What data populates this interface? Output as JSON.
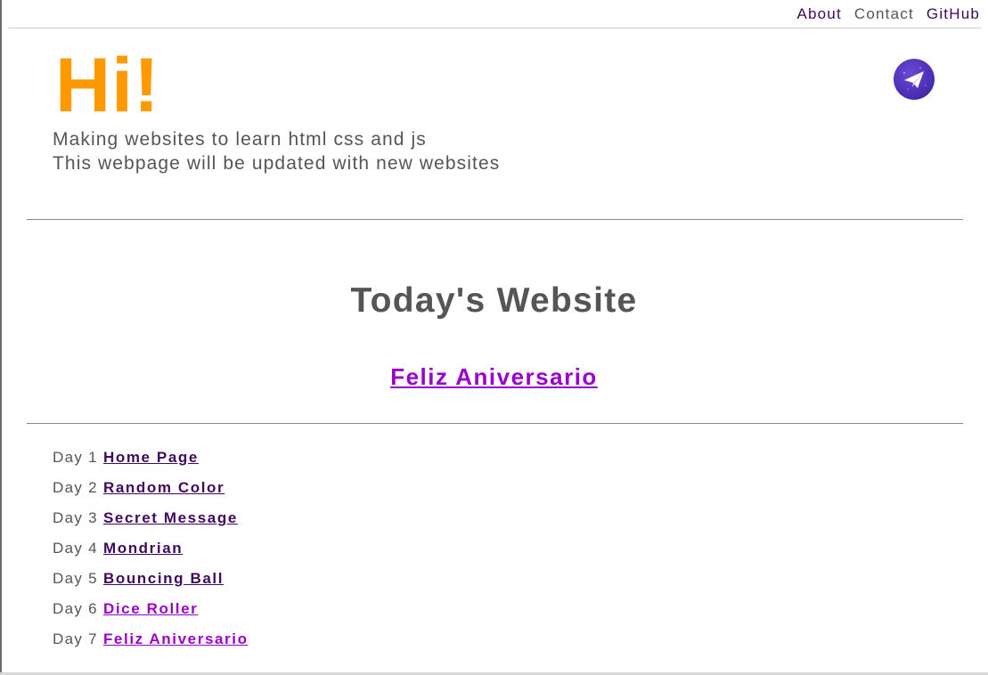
{
  "nav": {
    "about": "About",
    "contact": "Contact",
    "github": "GitHub"
  },
  "header": {
    "greeting": "Hi!",
    "tagline_1": "Making websites to learn html css and js",
    "tagline_2": "This webpage will be updated with new websites",
    "send_icon": "paper-plane-icon"
  },
  "today": {
    "title": "Today's Website",
    "link": "Feliz Aniversario"
  },
  "days": [
    {
      "prefix": "Day 1",
      "label": "Home Page"
    },
    {
      "prefix": "Day 2",
      "label": "Random Color"
    },
    {
      "prefix": "Day 3",
      "label": "Secret Message"
    },
    {
      "prefix": "Day 4",
      "label": "Mondrian"
    },
    {
      "prefix": "Day 5",
      "label": "Bouncing Ball"
    },
    {
      "prefix": "Day 6",
      "label": "Dice Roller"
    },
    {
      "prefix": "Day 7",
      "label": "Feliz Aniversario"
    }
  ],
  "colors": {
    "accent_orange": "#ff9900",
    "link_visited": "#3d0a5e",
    "link_unvisited": "#9900cc",
    "text_gray": "#555555"
  }
}
